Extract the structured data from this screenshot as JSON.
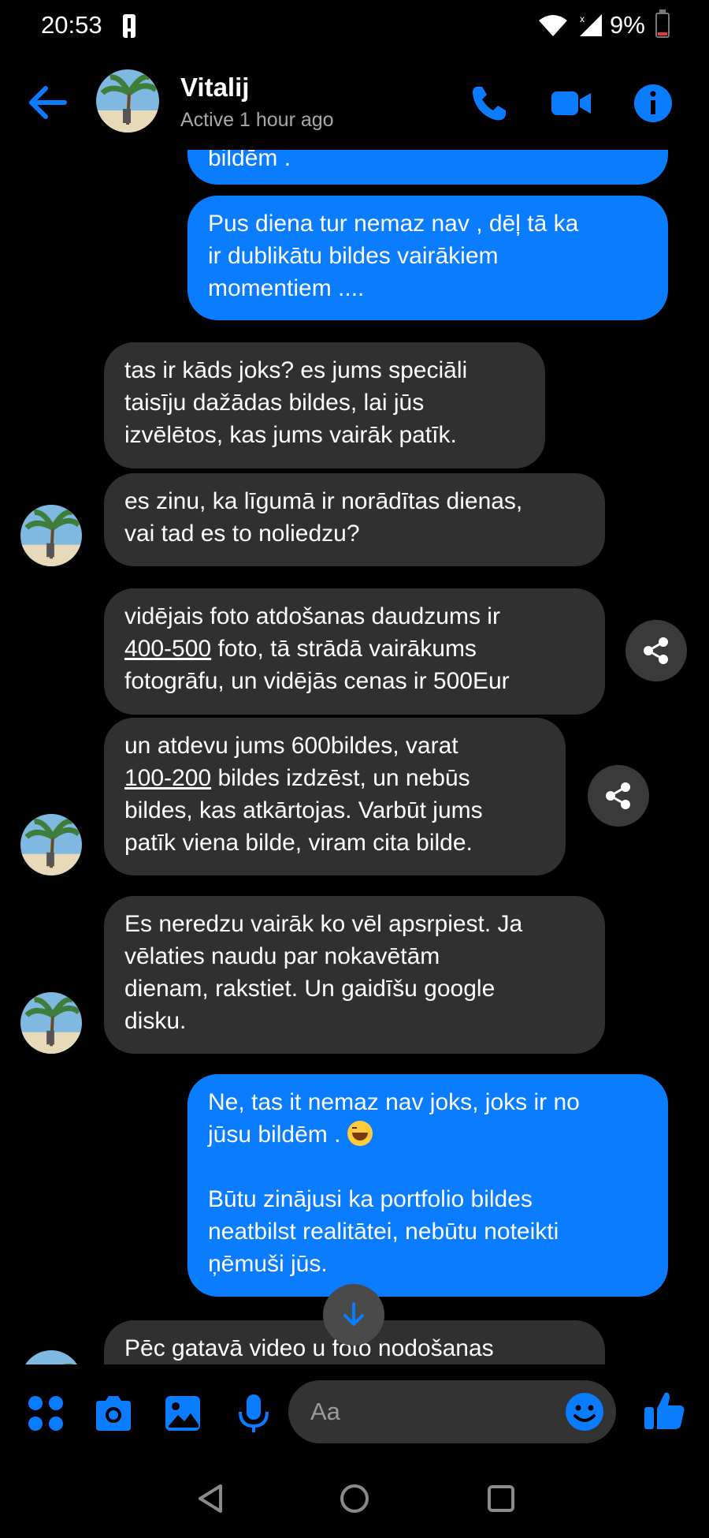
{
  "status_bar": {
    "time": "20:53",
    "battery": "9%"
  },
  "header": {
    "contact_name": "Vitalij",
    "contact_status": "Active 1 hour ago"
  },
  "messages": [
    {
      "side": "out",
      "lines": [
        "bildēm ."
      ]
    },
    {
      "side": "out",
      "lines": [
        "Pus diena tur nemaz nav , dēļ tā ka",
        "ir dublikātu bildes vairākiem",
        "momentiem ...."
      ]
    },
    {
      "side": "in",
      "lines": [
        "tas ir kāds joks? es jums speciāli",
        "taisīju dažādas bildes, lai jūs",
        "izvēlētos, kas jums vairāk patīk."
      ]
    },
    {
      "side": "in",
      "lines": [
        "es zinu, ka līgumā ir norādītas dienas,",
        "vai tad es to noliedzu?"
      ]
    },
    {
      "side": "in",
      "lines": [
        "vidējais foto atdošanas daudzums ir",
        "foto, tā strādā vairākums",
        "fotogrāfu, un vidējās cenas ir 500Eur"
      ],
      "link": "400-500"
    },
    {
      "side": "in",
      "lines": [
        "un atdevu jums 600bildes, varat",
        "bildes izdzēst, un nebūs",
        "bildes, kas atkārtojas. Varbūt jums",
        "patīk viena bilde, viram cita bilde."
      ],
      "link": "100-200"
    },
    {
      "side": "in",
      "lines": [
        "Es neredzu vairāk ko vēl apsrpiest. Ja",
        "vēlaties naudu par nokavētām",
        "dienam, rakstiet. Un gaidīšu google",
        "disku."
      ]
    },
    {
      "side": "out",
      "lines": [
        "Ne, tas it nemaz nav joks, joks ir no",
        "jūsu bildēm .",
        "",
        "Būtu zinājusi ka portfolio bildes",
        "neatbilst realitātei, nebūtu noteikti",
        "ņēmuši jūs."
      ]
    },
    {
      "side": "in",
      "lines": [
        "Pēc gatavā video u foto nodošanas"
      ]
    }
  ],
  "composer": {
    "placeholder": "Aa"
  },
  "colors": {
    "accent": "#0a7cff",
    "incoming_bubble": "#303030",
    "background": "#000000"
  },
  "icons": [
    "back-arrow-icon",
    "phone-icon",
    "video-camera-icon",
    "info-icon",
    "share-icon",
    "arrow-down-icon",
    "menu-dots-icon",
    "camera-icon",
    "image-icon",
    "microphone-icon",
    "emoji-icon",
    "thumbs-up-icon"
  ]
}
